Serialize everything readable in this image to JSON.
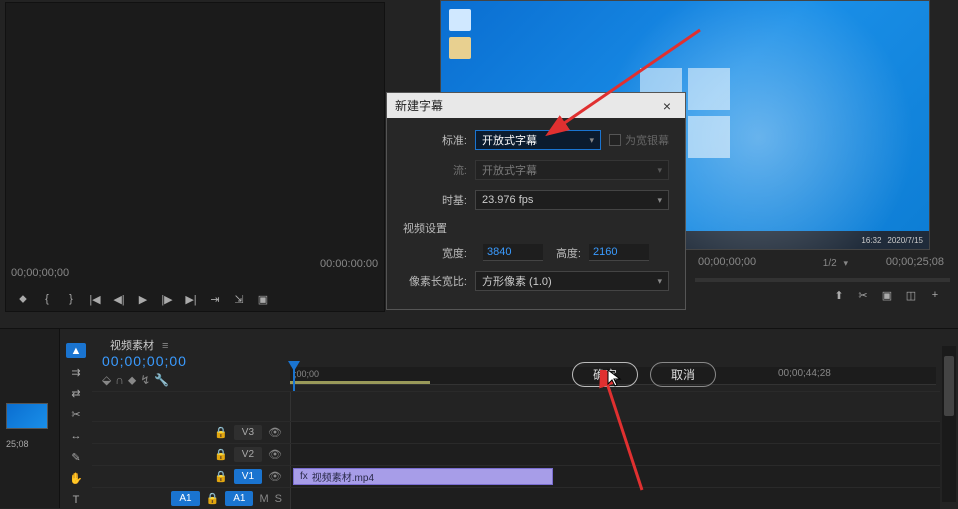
{
  "dialog": {
    "title": "新建字幕",
    "labels": {
      "standard": "标准:",
      "stream": "流:",
      "timebase": "时基:",
      "video_settings": "视频设置",
      "width": "宽度:",
      "height": "高度:",
      "pixel_aspect": "像素长宽比:"
    },
    "values": {
      "standard": "开放式字幕",
      "stream": "开放式字幕",
      "timebase": "23.976 fps",
      "width": "3840",
      "height": "2160",
      "pixel_aspect": "方形像素 (1.0)"
    },
    "checkbox_label": "为宽银幕",
    "buttons": {
      "ok": "确定",
      "cancel": "取消"
    }
  },
  "source": {
    "tc_left": "00;00;00;00",
    "tc_right": "00:00:00:00"
  },
  "program": {
    "tc_left": "00;00;00;00",
    "zoom": "1/2",
    "tc_right": "00;00;25;08"
  },
  "taskbar": {
    "time": "16:32",
    "date": "2020/7/15"
  },
  "timeline": {
    "tab": "视频素材",
    "tc": "00;00;00;00",
    "ruler": {
      "start": ";00;00",
      "r2": "00;00;44;28"
    },
    "tracks": {
      "v3": "V3",
      "v2": "V2",
      "v1": "V1",
      "a1_src": "A1",
      "a1": "A1"
    },
    "clip": {
      "name": "视频素材.mp4"
    }
  },
  "project": {
    "thumb_tc": "25;08"
  }
}
